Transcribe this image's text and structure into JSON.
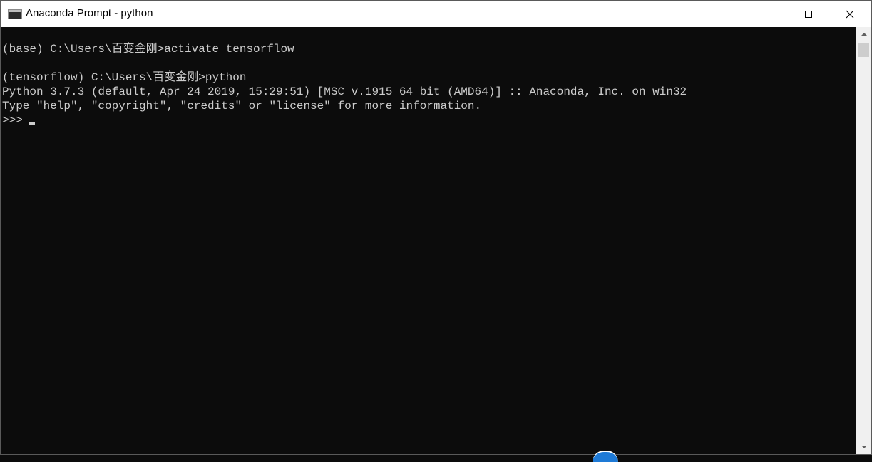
{
  "window": {
    "title": "Anaconda Prompt - python",
    "icon": "console-icon"
  },
  "controls": {
    "minimize": "minimize-icon",
    "maximize": "maximize-icon",
    "close_glyph": "✕"
  },
  "console": {
    "lines": [
      "(base) C:\\Users\\百变金刚>activate tensorflow",
      "(tensorflow) C:\\Users\\百变金刚>python",
      "Python 3.7.3 (default, Apr 24 2019, 15:29:51) [MSC v.1915 64 bit (AMD64)] :: Anaconda, Inc. on win32",
      "Type \"help\", \"copyright\", \"credits\" or \"license\" for more information."
    ],
    "prompt": ">>>"
  },
  "colors": {
    "console_bg": "#0c0c0c",
    "console_fg": "#cccccc",
    "titlebar_bg": "#ffffff"
  }
}
